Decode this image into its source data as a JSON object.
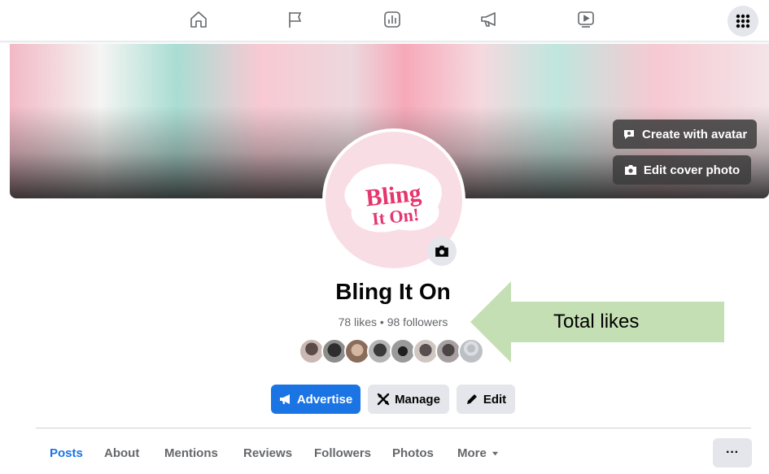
{
  "topnav": {
    "icons": [
      "home-icon",
      "flag-icon",
      "insights-icon",
      "megaphone-icon",
      "video-icon",
      "apps-grid-icon"
    ]
  },
  "cover": {
    "create_avatar_label": "Create with avatar",
    "edit_cover_label": "Edit cover photo"
  },
  "profile": {
    "logo_text_line1": "Bling",
    "logo_text_line2": "It On!",
    "name": "Bling It On",
    "stats": "78 likes • 98 followers",
    "follower_avatar_count": 8
  },
  "annotation": {
    "label": "Total likes",
    "color": "#c5dfb4"
  },
  "actions": {
    "advertise_label": "Advertise",
    "manage_label": "Manage",
    "edit_label": "Edit"
  },
  "tabs": {
    "items": [
      "Posts",
      "About",
      "Mentions",
      "Reviews",
      "Followers",
      "Photos",
      "More"
    ],
    "active": "Posts",
    "more_button": "···"
  },
  "colors": {
    "accent": "#1b74e4",
    "secondary_button": "#e4e6eb",
    "muted_text": "#65676b",
    "logo_pink": "#e6356f"
  }
}
